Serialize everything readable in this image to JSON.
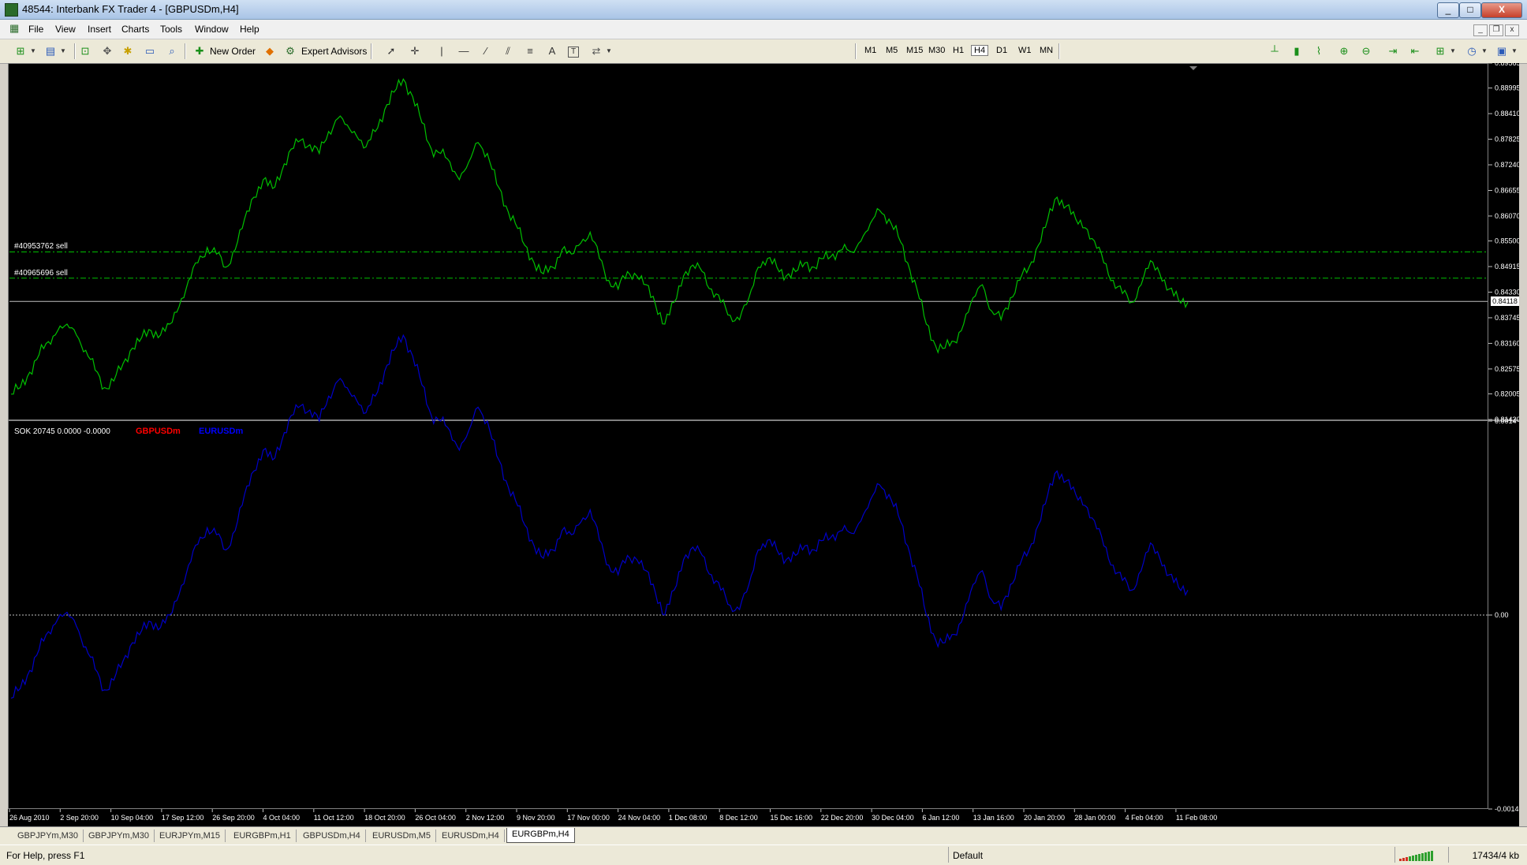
{
  "window": {
    "title": "48544: Interbank FX Trader 4 - [GBPUSDm,H4]",
    "minimize": "_",
    "maximize": "□",
    "close": "X",
    "mdi_min": "_",
    "mdi_restore": "❐",
    "mdi_close": "x"
  },
  "menu": [
    "File",
    "View",
    "Insert",
    "Charts",
    "Tools",
    "Window",
    "Help"
  ],
  "toolbar": {
    "new_order": "New Order",
    "expert_advisors": "Expert Advisors",
    "text_tool": "A",
    "label_tool": "T",
    "timeframes": [
      "M1",
      "M5",
      "M15",
      "M30",
      "H1",
      "H4",
      "D1",
      "W1",
      "MN"
    ],
    "active_timeframe": "H4"
  },
  "chart_data": [
    {
      "type": "line",
      "symbol": "GBPUSDm",
      "color": "#00c000",
      "x_labels": [
        "26 Aug 2010",
        "2 Sep 20:00",
        "10 Sep 04:00",
        "17 Sep 12:00",
        "26 Sep 20:00",
        "4 Oct 04:00",
        "11 Oct 12:00",
        "18 Oct 20:00",
        "26 Oct 04:00",
        "2 Nov 12:00",
        "9 Nov 20:00",
        "17 Nov 00:00",
        "24 Nov 04:00",
        "1 Dec 08:00",
        "8 Dec 12:00",
        "15 Dec 16:00",
        "22 Dec 20:00",
        "30 Dec 04:00",
        "6 Jan 12:00",
        "13 Jan 16:00",
        "20 Jan 20:00",
        "28 Jan 00:00",
        "4 Feb 04:00",
        "11 Feb 08:00"
      ],
      "y_ticks": [
        "0.89565",
        "0.88995",
        "0.88410",
        "0.87825",
        "0.87240",
        "0.86655",
        "0.86070",
        "0.85500",
        "0.84915",
        "0.84330",
        "0.83745",
        "0.83160",
        "0.82575",
        "0.82005",
        "0.81420"
      ],
      "ylim": [
        0.8142,
        0.89565
      ],
      "current_price": "0.84118",
      "current_price_value": 0.84118,
      "order_lines": [
        {
          "label": "#40953762 sell",
          "price": 0.8525
        },
        {
          "label": "#40965696 sell",
          "price": 0.8465
        }
      ],
      "values": [
        0.82,
        0.8215,
        0.825,
        0.829,
        0.832,
        0.8345,
        0.836,
        0.8335,
        0.83,
        0.8255,
        0.8215,
        0.823,
        0.827,
        0.8305,
        0.833,
        0.8345,
        0.8335,
        0.836,
        0.84,
        0.846,
        0.85,
        0.8535,
        0.852,
        0.849,
        0.853,
        0.86,
        0.865,
        0.869,
        0.867,
        0.871,
        0.876,
        0.878,
        0.877,
        0.875,
        0.88,
        0.883,
        0.8815,
        0.879,
        0.8765,
        0.88,
        0.885,
        0.889,
        0.892,
        0.888,
        0.882,
        0.876,
        0.875,
        0.873,
        0.869,
        0.873,
        0.8775,
        0.875,
        0.868,
        0.863,
        0.859,
        0.854,
        0.85,
        0.8475,
        0.849,
        0.853,
        0.852,
        0.8545,
        0.857,
        0.851,
        0.846,
        0.844,
        0.848,
        0.847,
        0.845,
        0.8405,
        0.836,
        0.841,
        0.847,
        0.8495,
        0.848,
        0.844,
        0.841,
        0.838,
        0.837,
        0.842,
        0.849,
        0.851,
        0.849,
        0.847,
        0.848,
        0.85,
        0.849,
        0.851,
        0.852,
        0.853,
        0.8525,
        0.855,
        0.859,
        0.862,
        0.86,
        0.856,
        0.85,
        0.844,
        0.836,
        0.831,
        0.8305,
        0.832,
        0.836,
        0.842,
        0.845,
        0.839,
        0.837,
        0.842,
        0.846,
        0.849,
        0.854,
        0.86,
        0.865,
        0.863,
        0.86,
        0.858,
        0.855,
        0.85,
        0.846,
        0.843,
        0.841,
        0.845,
        0.8505,
        0.8475,
        0.844,
        0.8415,
        0.841
      ]
    },
    {
      "type": "line",
      "indicator_label": "SOK 20745 0.0000 -0.0000",
      "legend": [
        {
          "name": "GBPUSDm",
          "color": "#ff0000"
        },
        {
          "name": "EURUSDm",
          "color": "#0000ff"
        }
      ],
      "series_color": "#0000c8",
      "y_ticks": [
        "0.0014",
        "0.00",
        "-0.0014"
      ],
      "ylim": [
        -0.0014,
        0.0014
      ],
      "zero_line": 0,
      "values": [
        -0.0006,
        -0.00053,
        -0.0004,
        -0.00025,
        -0.00012,
        -3e-05,
        2e-05,
        -8e-05,
        -0.00023,
        -0.00039,
        -0.00054,
        -0.00047,
        -0.00033,
        -0.0002,
        -0.00011,
        -5e-05,
        -9e-05,
        0.0,
        0.00015,
        0.00036,
        0.00051,
        0.00063,
        0.00058,
        0.00047,
        0.00061,
        0.00087,
        0.00104,
        0.00119,
        0.00112,
        0.00126,
        0.00144,
        0.00151,
        0.00148,
        0.0014,
        0.00158,
        0.00169,
        0.00164,
        0.00155,
        0.00146,
        0.00158,
        0.00176,
        0.00191,
        0.00202,
        0.00187,
        0.00166,
        0.00144,
        0.0014,
        0.00133,
        0.00119,
        0.00133,
        0.0015,
        0.0014,
        0.00115,
        0.00097,
        0.00083,
        0.00065,
        0.0005,
        0.00041,
        0.00047,
        0.00061,
        0.00058,
        0.00067,
        0.00076,
        0.00054,
        0.00036,
        0.00029,
        0.00043,
        0.0004,
        0.00032,
        0.00016,
        0.0,
        0.00018,
        0.0004,
        0.00049,
        0.00043,
        0.00029,
        0.00018,
        7e-05,
        4e-05,
        0.00022,
        0.00047,
        0.00054,
        0.00047,
        0.0004,
        0.00043,
        0.0005,
        0.00047,
        0.00054,
        0.00058,
        0.00061,
        0.00059,
        0.00068,
        0.00083,
        0.00094,
        0.00087,
        0.00072,
        0.0005,
        0.00029,
        0.0,
        -0.00018,
        -0.0002,
        -0.00014,
        0.0,
        0.00022,
        0.00032,
        0.00011,
        4e-05,
        0.00022,
        0.00036,
        0.00047,
        0.00065,
        0.00087,
        0.00104,
        0.00097,
        0.00087,
        0.00079,
        0.00068,
        0.0005,
        0.00036,
        0.00025,
        0.00018,
        0.00032,
        0.00052,
        0.00041,
        0.00029,
        0.0002,
        0.00018
      ]
    }
  ],
  "tabs": [
    "GBPJPYm,M30",
    "GBPJPYm,M30",
    "EURJPYm,M15",
    "EURGBPm,H1",
    "GBPUSDm,H4",
    "EURUSDm,M5",
    "EURUSDm,H4",
    "EURGBPm,H4"
  ],
  "active_tab": "EURGBPm,H4",
  "status": {
    "help": "For Help, press F1",
    "profile": "Default",
    "traffic": "17434/4 kb"
  }
}
